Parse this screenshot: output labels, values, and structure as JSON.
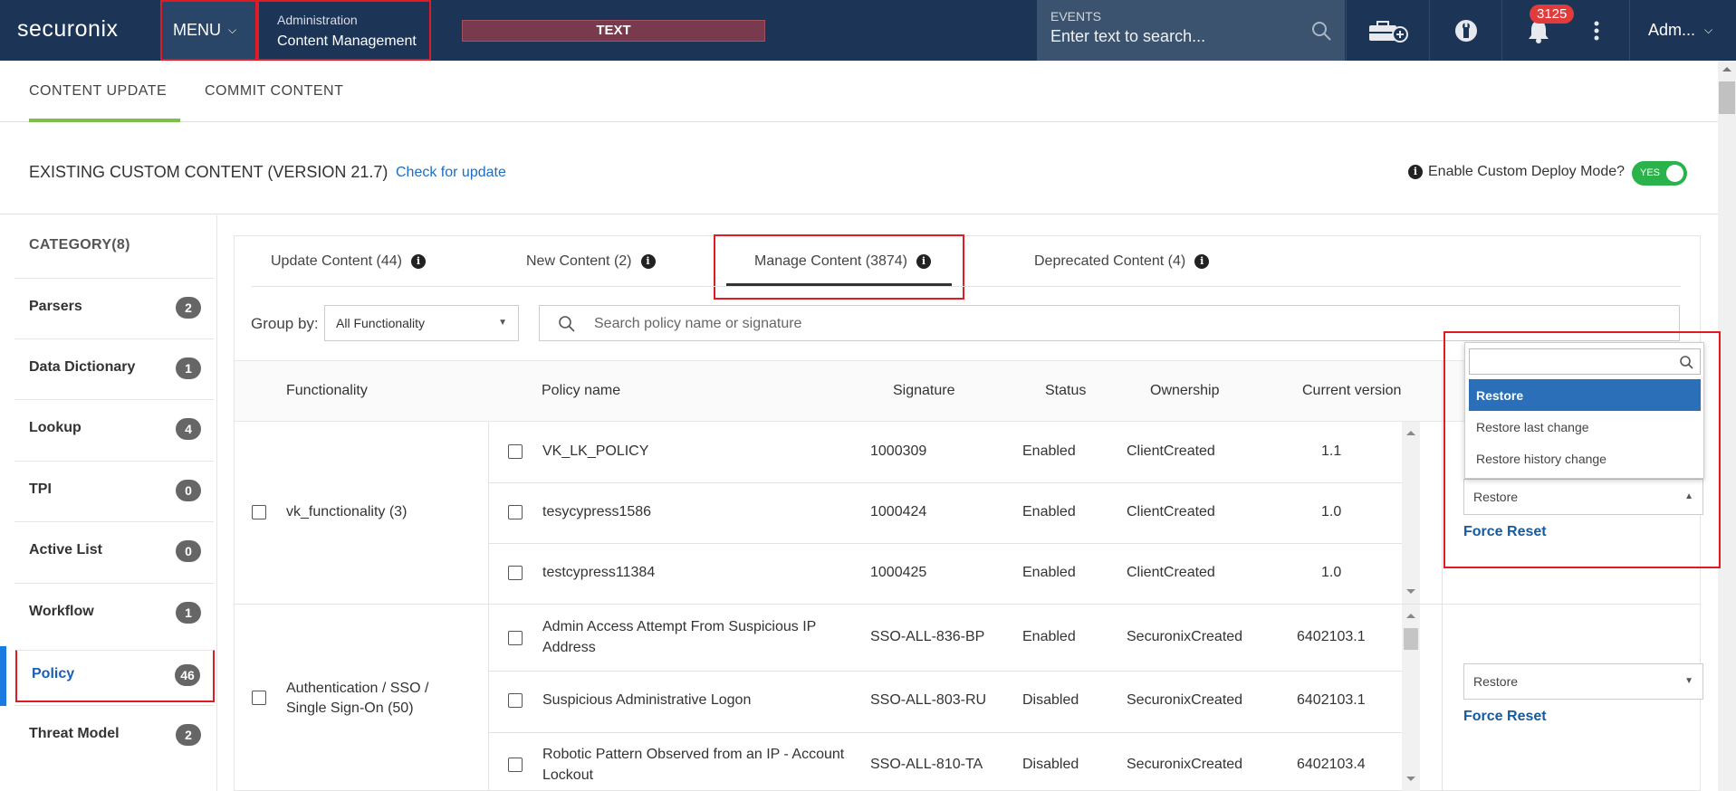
{
  "topbar": {
    "logo": "securonix",
    "menu_label": "MENU",
    "breadcrumb_section": "Administration",
    "breadcrumb_page": "Content Management",
    "text_banner": "TEXT",
    "events_label": "EVENTS",
    "events_placeholder": "Enter text to search...",
    "notification_count": "3125",
    "user_label": "Adm..."
  },
  "top_tabs": [
    "CONTENT UPDATE",
    "COMMIT CONTENT"
  ],
  "section": {
    "title": "EXISTING CUSTOM CONTENT (VERSION 21.7)",
    "check_update": "Check for update",
    "deploy_mode_label": "Enable Custom Deploy Mode?",
    "toggle_label": "YES"
  },
  "sidebar": {
    "title": "CATEGORY(8)",
    "items": [
      {
        "label": "Parsers",
        "count": "2"
      },
      {
        "label": "Data Dictionary",
        "count": "1"
      },
      {
        "label": "Lookup",
        "count": "4"
      },
      {
        "label": "TPI",
        "count": "0"
      },
      {
        "label": "Active List",
        "count": "0"
      },
      {
        "label": "Workflow",
        "count": "1"
      },
      {
        "label": "Policy",
        "count": "46"
      },
      {
        "label": "Threat Model",
        "count": "2"
      }
    ]
  },
  "main_tabs": [
    "Update Content (44)",
    "New Content (2)",
    "Manage Content (3874)",
    "Deprecated Content (4)"
  ],
  "group_by": {
    "label": "Group by:",
    "value": "All Functionality"
  },
  "search": {
    "placeholder": "Search policy name or signature"
  },
  "table": {
    "headers": [
      "Functionality",
      "Policy name",
      "Signature",
      "Status",
      "Ownership",
      "Current version"
    ],
    "groups": [
      {
        "functionality": "vk_functionality (3)",
        "rows": [
          {
            "name": "VK_LK_POLICY",
            "signature": "1000309",
            "status": "Enabled",
            "ownership": "ClientCreated",
            "version": "1.1"
          },
          {
            "name": "tesycypress1586",
            "signature": "1000424",
            "status": "Enabled",
            "ownership": "ClientCreated",
            "version": "1.0"
          },
          {
            "name": "testcypress11384",
            "signature": "1000425",
            "status": "Enabled",
            "ownership": "ClientCreated",
            "version": "1.0"
          }
        ],
        "action": "Restore",
        "force_reset": "Force Reset"
      },
      {
        "functionality": "Authentication / SSO / Single Sign-On (50)",
        "rows": [
          {
            "name": "Admin Access Attempt From Suspicious IP Address",
            "signature": "SSO-ALL-836-BP",
            "status": "Enabled",
            "ownership": "SecuronixCreated",
            "version": "6402103.1"
          },
          {
            "name": "Suspicious Administrative Logon",
            "signature": "SSO-ALL-803-RU",
            "status": "Disabled",
            "ownership": "SecuronixCreated",
            "version": "6402103.1"
          },
          {
            "name": "Robotic Pattern Observed from an IP - Account Lockout",
            "signature": "SSO-ALL-810-TA",
            "status": "Disabled",
            "ownership": "SecuronixCreated",
            "version": "6402103.4"
          }
        ],
        "action": "Restore",
        "force_reset": "Force Reset"
      }
    ]
  },
  "action_dropdown": {
    "options": [
      "Restore",
      "Restore last change",
      "Restore history change"
    ],
    "selected": "Restore"
  }
}
